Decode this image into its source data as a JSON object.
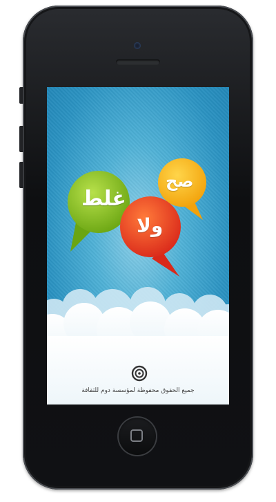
{
  "device": {
    "type": "smartphone",
    "body_color": "#111214",
    "screen": {
      "background_colors": [
        "#8fd0e8",
        "#2b93c2"
      ],
      "bubbles": [
        {
          "text": "غلط",
          "color": "#8ac21d"
        },
        {
          "text": "صح",
          "color": "#f7b515"
        },
        {
          "text": "ولا",
          "color": "#e53b1c"
        }
      ],
      "copyright": "جميع الحقوق محفوظة لمؤسسة دوم للثقافة"
    }
  }
}
